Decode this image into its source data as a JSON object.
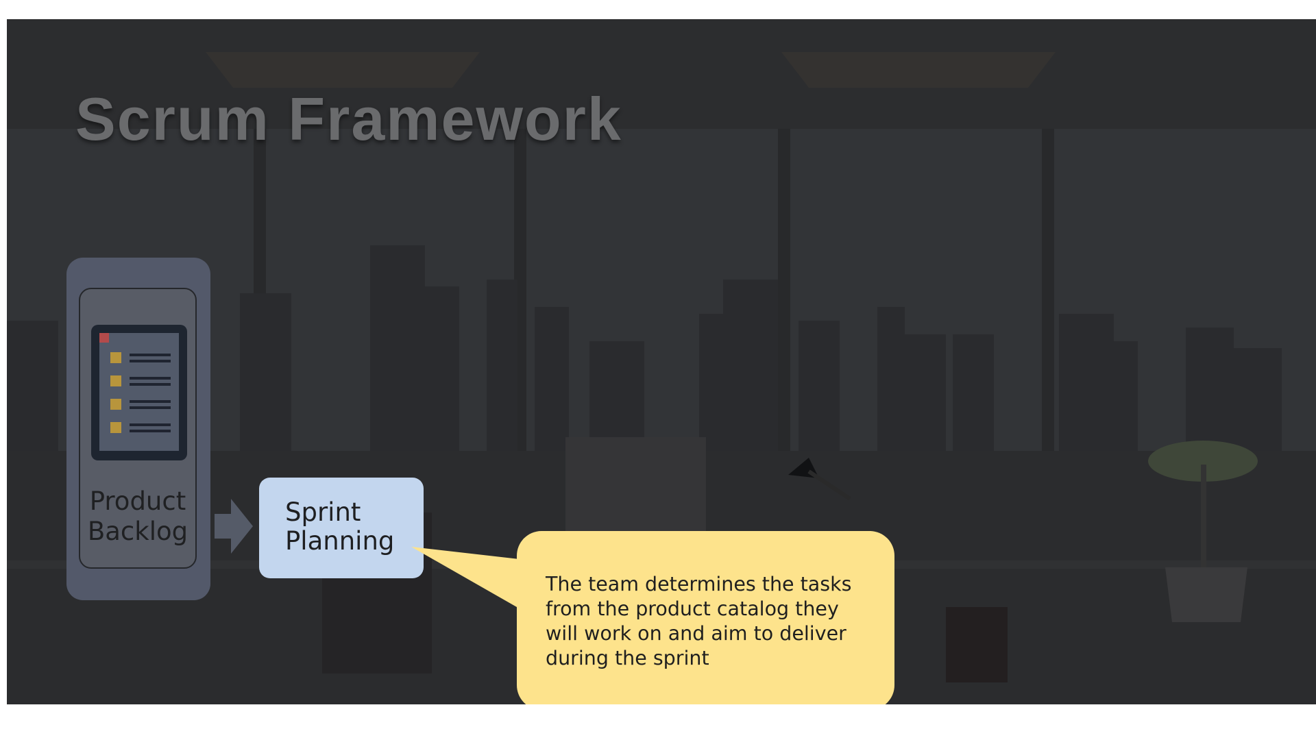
{
  "slide": {
    "title": "Scrum Framework",
    "top_bar_colors": [
      "#f6a623",
      "#ef6a31",
      "#1aa25a",
      "#1d86d8"
    ]
  },
  "diagram": {
    "product_backlog": {
      "label": "Product\nBacklog",
      "icon": "document-list-icon"
    },
    "flow_arrow": "arrow-right-icon",
    "sprint_planning": {
      "label": "Sprint\nPlanning"
    },
    "callout": {
      "text": "The team determines the tasks\nfrom the product catalog they\nwill work on and aim to deliver\nduring the sprint"
    }
  },
  "colors": {
    "background": "#2c2d2f",
    "backlog_card": "#53596a",
    "sprint_box": "#c3d6ee",
    "callout": "#fde38c"
  }
}
